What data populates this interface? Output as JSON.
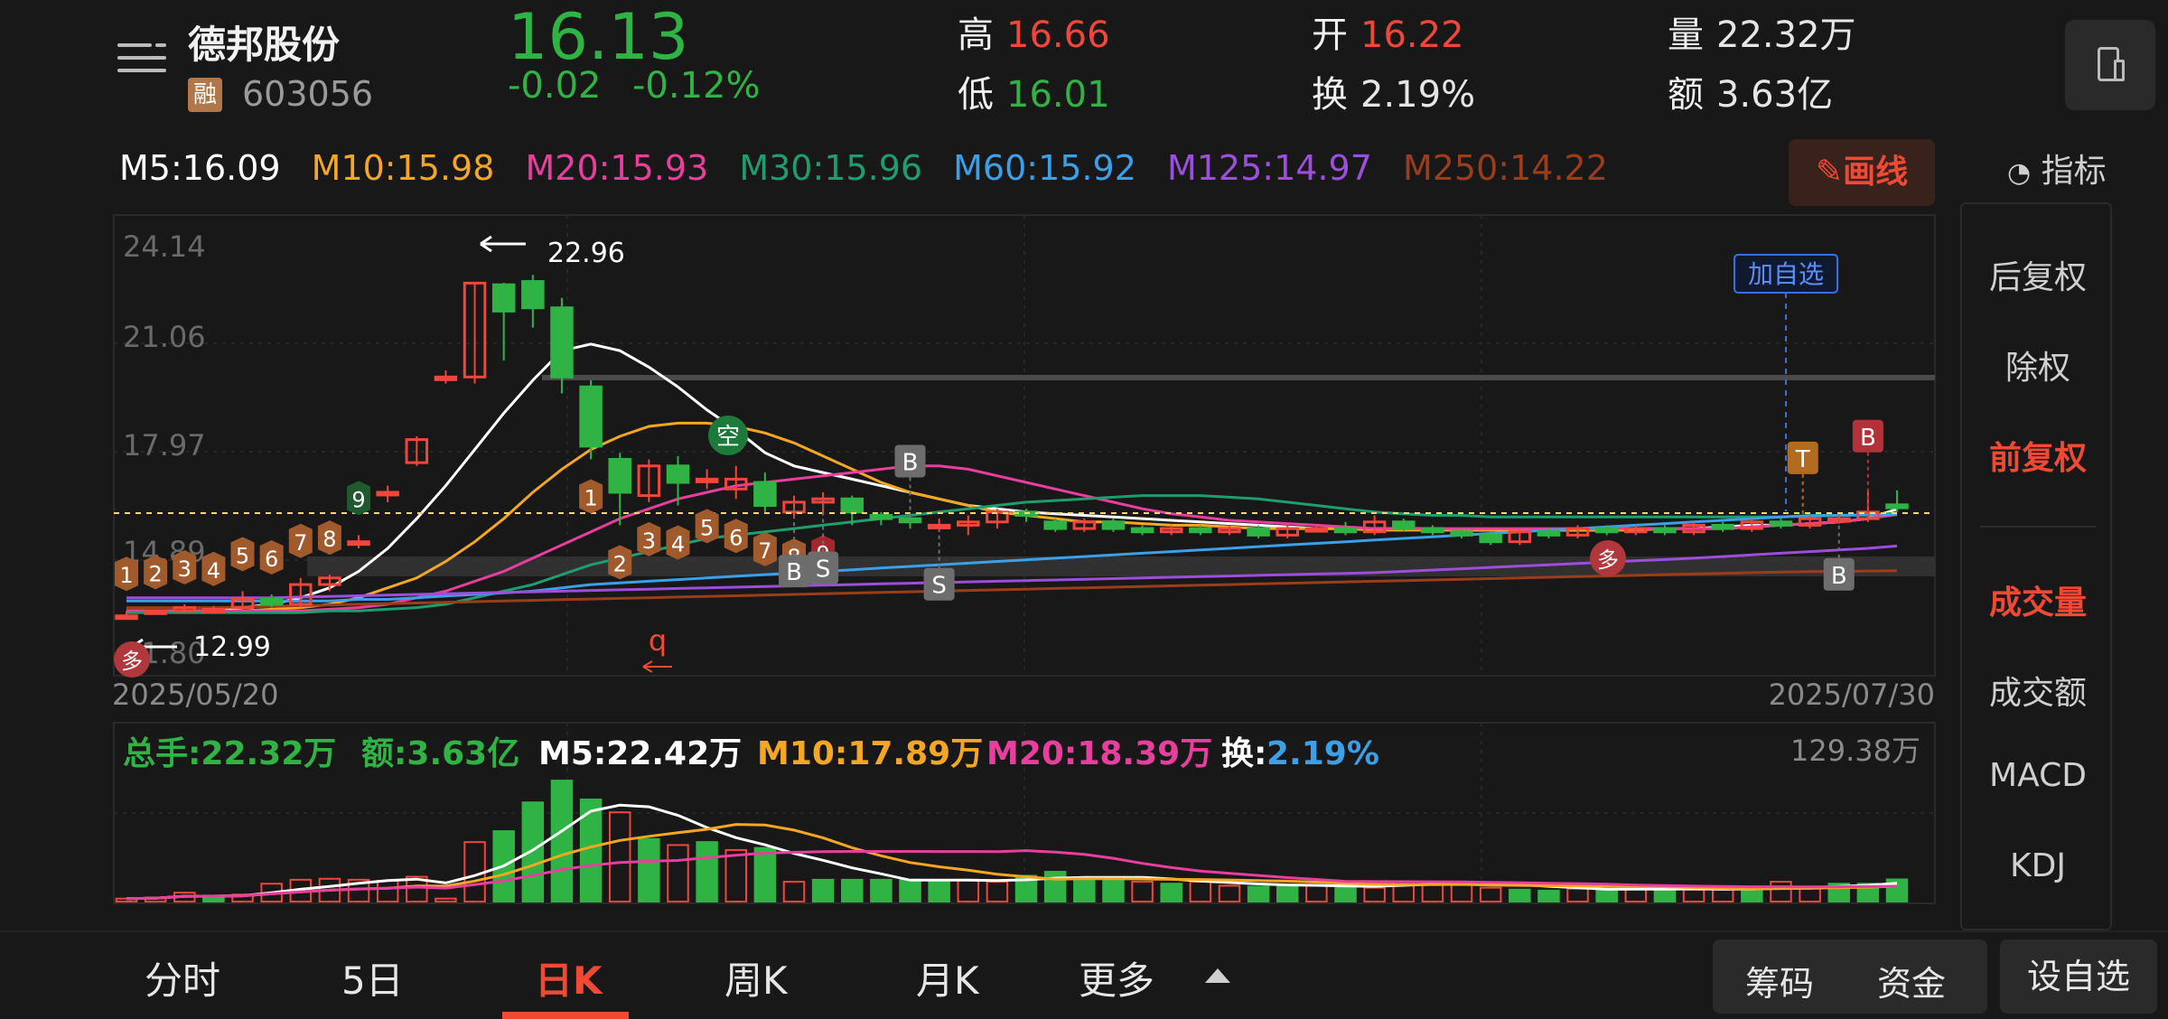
{
  "header": {
    "stock_name": "德邦股份",
    "rong_badge": "融",
    "stock_code": "603056",
    "price": "16.13",
    "change": "-0.02",
    "change_pct": "-0.12%",
    "high_label": "高",
    "high": "16.66",
    "low_label": "低",
    "low": "16.01",
    "open_label": "开",
    "open": "16.22",
    "turnover_label": "换",
    "turnover": "2.19%",
    "volume_label": "量",
    "volume": "22.32万",
    "amount_label": "额",
    "amount": "3.63亿"
  },
  "ma": {
    "m5": "M5:16.09",
    "m10": "M10:15.98",
    "m20": "M20:15.93",
    "m30": "M30:15.96",
    "m60": "M60:15.92",
    "m125": "M125:14.97",
    "m250": "M250:14.22"
  },
  "draw_button": "画线",
  "indicator_button": "指标",
  "right_panel": [
    "后复权",
    "除权",
    "前复权",
    "成交量",
    "成交额",
    "MACD",
    "KDJ"
  ],
  "price_chart": {
    "y_labels": [
      "24.14",
      "21.06",
      "17.97",
      "14.89",
      "11.80"
    ],
    "date_start": "2025/05/20",
    "date_end": "2025/07/30",
    "max_label": "22.96",
    "min_label": "12.99",
    "add_watch": "加自选",
    "kong": "空",
    "duo": "多",
    "q_mark": "q",
    "markers": [
      "1",
      "2",
      "3",
      "4",
      "5",
      "6",
      "7",
      "8",
      "9",
      "1",
      "2",
      "3",
      "4",
      "5",
      "6",
      "7",
      "8",
      "9",
      "B",
      "S",
      "B",
      "S",
      "B",
      "B",
      "T",
      "B"
    ]
  },
  "volume_chart": {
    "total_hands": "总手:22.32万",
    "amount": "额:3.63亿",
    "m5": "M5:22.42万",
    "m10": "M10:17.89万",
    "m20": "M20:18.39万",
    "turnover_label": "换:",
    "turnover": "2.19%",
    "max_label": "129.38万"
  },
  "tabs": [
    "分时",
    "5日",
    "日K",
    "周K",
    "月K",
    "更多"
  ],
  "bottom_buttons": {
    "chips": "筹码",
    "funds": "资金",
    "add_fav": "设自选"
  },
  "colors": {
    "up": "#f0463c",
    "down": "#2fb344",
    "m5": "#ffffff",
    "m10": "#f5a623",
    "m20": "#e83e9d",
    "m30": "#1e9e6e",
    "m60": "#3aa0ea",
    "m125": "#9d4edd",
    "m250": "#9b3d1a"
  },
  "chart_data": {
    "type": "candlestick",
    "title": "",
    "x_range": [
      "2025/05/20",
      "2025/07/30"
    ],
    "ylim": [
      11.8,
      24.14
    ],
    "candles": [
      {
        "o": 12.85,
        "c": 12.85,
        "h": 13.0,
        "l": 12.8
      },
      {
        "o": 12.95,
        "c": 13.0,
        "h": 13.05,
        "l": 12.9
      },
      {
        "o": 13.0,
        "c": 13.1,
        "h": 13.2,
        "l": 12.95
      },
      {
        "o": 13.05,
        "c": 13.05,
        "h": 13.15,
        "l": 13.0
      },
      {
        "o": 13.1,
        "c": 13.35,
        "h": 13.6,
        "l": 13.05
      },
      {
        "o": 13.35,
        "c": 13.2,
        "h": 13.5,
        "l": 13.1
      },
      {
        "o": 13.2,
        "c": 13.8,
        "h": 14.0,
        "l": 13.1
      },
      {
        "o": 13.8,
        "c": 14.0,
        "h": 14.1,
        "l": 13.6
      },
      {
        "o": 15.1,
        "c": 15.1,
        "h": 15.3,
        "l": 14.9
      },
      {
        "o": 16.6,
        "c": 16.6,
        "h": 16.8,
        "l": 16.3
      },
      {
        "o": 17.5,
        "c": 18.2,
        "h": 18.3,
        "l": 17.4
      },
      {
        "o": 20.1,
        "c": 20.1,
        "h": 20.3,
        "l": 19.9
      },
      {
        "o": 20.1,
        "c": 22.95,
        "h": 22.96,
        "l": 19.9
      },
      {
        "o": 22.9,
        "c": 22.1,
        "h": 22.96,
        "l": 20.6
      },
      {
        "o": 23.0,
        "c": 22.2,
        "h": 23.2,
        "l": 21.6
      },
      {
        "o": 22.2,
        "c": 20.1,
        "h": 22.5,
        "l": 19.6
      },
      {
        "o": 19.8,
        "c": 18.0,
        "h": 20.0,
        "l": 17.6
      },
      {
        "o": 17.6,
        "c": 16.6,
        "h": 17.8,
        "l": 15.6
      },
      {
        "o": 16.5,
        "c": 17.4,
        "h": 17.6,
        "l": 16.3
      },
      {
        "o": 17.4,
        "c": 16.9,
        "h": 17.7,
        "l": 16.2
      },
      {
        "o": 17.0,
        "c": 17.0,
        "h": 17.3,
        "l": 16.7
      },
      {
        "o": 16.7,
        "c": 17.0,
        "h": 17.4,
        "l": 16.4
      },
      {
        "o": 16.9,
        "c": 16.2,
        "h": 17.2,
        "l": 16.0
      },
      {
        "o": 16.0,
        "c": 16.3,
        "h": 16.5,
        "l": 15.8
      },
      {
        "o": 16.3,
        "c": 16.4,
        "h": 16.6,
        "l": 15.9
      },
      {
        "o": 16.4,
        "c": 16.0,
        "h": 16.5,
        "l": 15.6
      },
      {
        "o": 15.9,
        "c": 15.8,
        "h": 16.0,
        "l": 15.6
      },
      {
        "o": 15.8,
        "c": 15.7,
        "h": 15.9,
        "l": 15.5
      },
      {
        "o": 15.6,
        "c": 15.6,
        "h": 15.8,
        "l": 15.4
      },
      {
        "o": 15.6,
        "c": 15.7,
        "h": 15.9,
        "l": 15.3
      },
      {
        "o": 15.7,
        "c": 16.0,
        "h": 16.1,
        "l": 15.5
      },
      {
        "o": 16.0,
        "c": 15.9,
        "h": 16.1,
        "l": 15.7
      },
      {
        "o": 15.7,
        "c": 15.5,
        "h": 15.8,
        "l": 15.4
      },
      {
        "o": 15.5,
        "c": 15.7,
        "h": 15.8,
        "l": 15.4
      },
      {
        "o": 15.7,
        "c": 15.5,
        "h": 15.8,
        "l": 15.4
      },
      {
        "o": 15.5,
        "c": 15.4,
        "h": 15.6,
        "l": 15.3
      },
      {
        "o": 15.4,
        "c": 15.5,
        "h": 15.6,
        "l": 15.3
      },
      {
        "o": 15.5,
        "c": 15.4,
        "h": 15.6,
        "l": 15.3
      },
      {
        "o": 15.4,
        "c": 15.5,
        "h": 15.6,
        "l": 15.3
      },
      {
        "o": 15.5,
        "c": 15.3,
        "h": 15.6,
        "l": 15.2
      },
      {
        "o": 15.3,
        "c": 15.5,
        "h": 15.6,
        "l": 15.2
      },
      {
        "o": 15.5,
        "c": 15.5,
        "h": 15.6,
        "l": 15.4
      },
      {
        "o": 15.5,
        "c": 15.4,
        "h": 15.7,
        "l": 15.3
      },
      {
        "o": 15.4,
        "c": 15.7,
        "h": 15.9,
        "l": 15.3
      },
      {
        "o": 15.7,
        "c": 15.5,
        "h": 15.8,
        "l": 15.4
      },
      {
        "o": 15.5,
        "c": 15.4,
        "h": 15.6,
        "l": 15.3
      },
      {
        "o": 15.4,
        "c": 15.3,
        "h": 15.5,
        "l": 15.2
      },
      {
        "o": 15.3,
        "c": 15.1,
        "h": 15.4,
        "l": 15.0
      },
      {
        "o": 15.1,
        "c": 15.4,
        "h": 15.5,
        "l": 15.0
      },
      {
        "o": 15.4,
        "c": 15.3,
        "h": 15.5,
        "l": 15.2
      },
      {
        "o": 15.3,
        "c": 15.5,
        "h": 15.6,
        "l": 15.2
      },
      {
        "o": 15.5,
        "c": 15.4,
        "h": 15.6,
        "l": 15.3
      },
      {
        "o": 15.4,
        "c": 15.5,
        "h": 15.6,
        "l": 15.3
      },
      {
        "o": 15.5,
        "c": 15.4,
        "h": 15.6,
        "l": 15.3
      },
      {
        "o": 15.4,
        "c": 15.6,
        "h": 15.7,
        "l": 15.3
      },
      {
        "o": 15.6,
        "c": 15.5,
        "h": 15.7,
        "l": 15.4
      },
      {
        "o": 15.5,
        "c": 15.7,
        "h": 15.8,
        "l": 15.4
      },
      {
        "o": 15.7,
        "c": 15.6,
        "h": 15.8,
        "l": 15.5
      },
      {
        "o": 15.6,
        "c": 15.8,
        "h": 15.9,
        "l": 15.5
      },
      {
        "o": 15.8,
        "c": 15.8,
        "h": 16.0,
        "l": 15.7
      },
      {
        "o": 15.8,
        "c": 16.0,
        "h": 16.66,
        "l": 15.7
      },
      {
        "o": 16.22,
        "c": 16.13,
        "h": 16.66,
        "l": 16.01
      }
    ],
    "ma_series": [
      {
        "name": "M5",
        "values": [
          13.0,
          13.0,
          13.0,
          13.0,
          13.1,
          13.2,
          13.4,
          13.7,
          14.2,
          14.9,
          15.8,
          16.8,
          17.9,
          19.0,
          20.0,
          20.9,
          21.1,
          20.9,
          20.4,
          19.8,
          19.1,
          18.5,
          17.8,
          17.4,
          17.2,
          17.0,
          16.8,
          16.6,
          16.4,
          16.2,
          16.1,
          16.0,
          15.95,
          15.9,
          15.85,
          15.8,
          15.75,
          15.7,
          15.65,
          15.6,
          15.55,
          15.5,
          15.5,
          15.5,
          15.5,
          15.5,
          15.45,
          15.45,
          15.45,
          15.45,
          15.45,
          15.45,
          15.5,
          15.5,
          15.5,
          15.55,
          15.6,
          15.6,
          15.65,
          15.7,
          15.8,
          16.09
        ]
      },
      {
        "name": "M10",
        "values": [
          13.0,
          13.0,
          13.0,
          13.0,
          13.0,
          13.05,
          13.1,
          13.2,
          13.4,
          13.7,
          14.0,
          14.5,
          15.1,
          15.8,
          16.6,
          17.3,
          17.9,
          18.3,
          18.6,
          18.7,
          18.7,
          18.6,
          18.4,
          18.1,
          17.7,
          17.3,
          16.9,
          16.6,
          16.4,
          16.2,
          16.0,
          15.9,
          15.8,
          15.7,
          15.7,
          15.65,
          15.6,
          15.6,
          15.55,
          15.5,
          15.5,
          15.5,
          15.5,
          15.45,
          15.45,
          15.45,
          15.45,
          15.45,
          15.45,
          15.45,
          15.45,
          15.45,
          15.45,
          15.5,
          15.5,
          15.5,
          15.55,
          15.6,
          15.65,
          15.7,
          15.8,
          15.98
        ]
      },
      {
        "name": "M20",
        "values": [
          13.0,
          13.0,
          13.0,
          13.0,
          13.0,
          13.0,
          13.0,
          13.05,
          13.1,
          13.2,
          13.4,
          13.6,
          13.9,
          14.2,
          14.6,
          15.0,
          15.4,
          15.8,
          16.1,
          16.4,
          16.6,
          16.8,
          16.9,
          17.0,
          17.1,
          17.2,
          17.3,
          17.4,
          17.4,
          17.3,
          17.1,
          16.9,
          16.7,
          16.5,
          16.3,
          16.1,
          15.95,
          15.85,
          15.75,
          15.7,
          15.65,
          15.6,
          15.55,
          15.5,
          15.5,
          15.5,
          15.5,
          15.5,
          15.5,
          15.5,
          15.5,
          15.5,
          15.5,
          15.5,
          15.5,
          15.5,
          15.55,
          15.6,
          15.65,
          15.7,
          15.8,
          15.93
        ]
      },
      {
        "name": "M30",
        "values": [
          12.95,
          12.95,
          12.95,
          12.95,
          12.95,
          12.95,
          12.95,
          13.0,
          13.0,
          13.05,
          13.1,
          13.2,
          13.4,
          13.6,
          13.8,
          14.1,
          14.4,
          14.6,
          14.8,
          15.0,
          15.2,
          15.3,
          15.4,
          15.5,
          15.6,
          15.7,
          15.8,
          15.9,
          16.0,
          16.1,
          16.2,
          16.3,
          16.35,
          16.4,
          16.45,
          16.5,
          16.5,
          16.5,
          16.45,
          16.4,
          16.3,
          16.2,
          16.1,
          16.0,
          15.95,
          15.9,
          15.9,
          15.85,
          15.85,
          15.85,
          15.85,
          15.85,
          15.85,
          15.85,
          15.85,
          15.85,
          15.85,
          15.85,
          15.9,
          15.9,
          15.92,
          15.96
        ]
      },
      {
        "name": "M60",
        "values": [
          13.3,
          13.3,
          13.3,
          13.3,
          13.3,
          13.3,
          13.3,
          13.3,
          13.35,
          13.35,
          13.4,
          13.45,
          13.5,
          13.55,
          13.6,
          13.7,
          13.8,
          13.85,
          13.9,
          13.95,
          14.0,
          14.05,
          14.1,
          14.15,
          14.2,
          14.25,
          14.3,
          14.35,
          14.4,
          14.45,
          14.5,
          14.55,
          14.6,
          14.65,
          14.7,
          14.75,
          14.8,
          14.85,
          14.9,
          14.95,
          15.0,
          15.05,
          15.1,
          15.15,
          15.2,
          15.25,
          15.3,
          15.35,
          15.4,
          15.45,
          15.5,
          15.55,
          15.6,
          15.65,
          15.7,
          15.75,
          15.8,
          15.85,
          15.88,
          15.9,
          15.91,
          15.92
        ]
      },
      {
        "name": "M125",
        "values": [
          13.4,
          13.4,
          13.4,
          13.4,
          13.4,
          13.4,
          13.42,
          13.44,
          13.46,
          13.48,
          13.5,
          13.52,
          13.54,
          13.56,
          13.58,
          13.6,
          13.62,
          13.64,
          13.66,
          13.68,
          13.7,
          13.72,
          13.74,
          13.76,
          13.78,
          13.8,
          13.82,
          13.84,
          13.86,
          13.88,
          13.9,
          13.92,
          13.94,
          13.96,
          13.98,
          14.0,
          14.02,
          14.04,
          14.06,
          14.08,
          14.1,
          14.12,
          14.14,
          14.16,
          14.2,
          14.24,
          14.28,
          14.32,
          14.36,
          14.4,
          14.44,
          14.48,
          14.52,
          14.56,
          14.6,
          14.65,
          14.7,
          14.75,
          14.8,
          14.85,
          14.9,
          14.97
        ]
      },
      {
        "name": "M250",
        "values": [
          13.1,
          13.1,
          13.1,
          13.1,
          13.12,
          13.14,
          13.16,
          13.18,
          13.2,
          13.22,
          13.24,
          13.26,
          13.28,
          13.3,
          13.32,
          13.34,
          13.36,
          13.38,
          13.4,
          13.42,
          13.44,
          13.46,
          13.48,
          13.5,
          13.52,
          13.54,
          13.56,
          13.58,
          13.6,
          13.62,
          13.64,
          13.66,
          13.68,
          13.7,
          13.72,
          13.74,
          13.76,
          13.78,
          13.8,
          13.82,
          13.84,
          13.86,
          13.88,
          13.9,
          13.92,
          13.94,
          13.96,
          13.98,
          14.0,
          14.02,
          14.04,
          14.06,
          14.08,
          14.1,
          14.12,
          14.14,
          14.16,
          14.18,
          14.19,
          14.2,
          14.21,
          14.22
        ]
      }
    ],
    "volume": {
      "ylim": [
        0,
        129.38
      ],
      "values": [
        3,
        4,
        9,
        6,
        7,
        18,
        22,
        23,
        22,
        21,
        25,
        3,
        60,
        71,
        100,
        122,
        103,
        90,
        63,
        57,
        60,
        52,
        54,
        20,
        22,
        22,
        22,
        22,
        20,
        22,
        20,
        26,
        30,
        24,
        22,
        20,
        18,
        20,
        16,
        15,
        15,
        16,
        17,
        14,
        20,
        20,
        20,
        14,
        12,
        11,
        13,
        12,
        15,
        12,
        12,
        12,
        12,
        20,
        14,
        18,
        18,
        22.32
      ],
      "up": [
        1,
        1,
        1,
        0,
        1,
        1,
        1,
        1,
        1,
        1,
        1,
        1,
        1,
        0,
        0,
        0,
        0,
        1,
        0,
        1,
        0,
        1,
        0,
        1,
        0,
        0,
        0,
        0,
        0,
        1,
        1,
        0,
        0,
        0,
        0,
        1,
        0,
        1,
        1,
        0,
        0,
        1,
        0,
        1,
        1,
        1,
        1,
        1,
        0,
        0,
        1,
        0,
        1,
        0,
        1,
        1,
        0,
        1,
        1,
        0,
        0,
        0
      ]
    }
  }
}
